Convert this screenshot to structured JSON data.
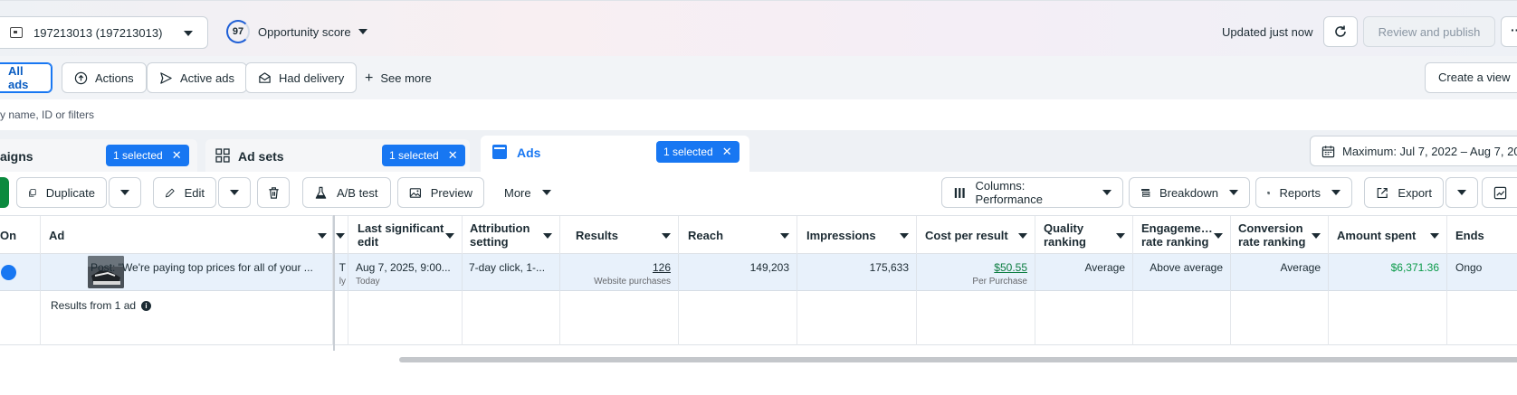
{
  "topbar": {
    "account": "197213013 (197213013)",
    "opportunity_score": "97",
    "opportunity_label": "Opportunity score",
    "updated": "Updated just now",
    "review_publish": "Review and publish",
    "more": "···"
  },
  "filters": {
    "all_ads": "All ads",
    "actions": "Actions",
    "active_ads": "Active ads",
    "had_delivery": "Had delivery",
    "see_more": "See more",
    "create_view": "Create a view"
  },
  "search": {
    "placeholder": "y name, ID or filters"
  },
  "tabs": {
    "campaigns": {
      "label": "aigns",
      "selected": "1 selected"
    },
    "adsets": {
      "label": "Ad sets",
      "selected": "1 selected"
    },
    "ads": {
      "label": "Ads",
      "selected": "1 selected"
    },
    "date_range": "Maximum: Jul 7, 2022 – Aug 7, 20"
  },
  "toolbar": {
    "duplicate": "Duplicate",
    "edit": "Edit",
    "ab_test": "A/B test",
    "preview": "Preview",
    "more": "More",
    "columns": "Columns: Performance",
    "breakdown": "Breakdown",
    "reports": "Reports",
    "export": "Export"
  },
  "table": {
    "headers": {
      "on": "On",
      "ad": "Ad",
      "last_edit_1": "Last significant",
      "last_edit_2": "edit",
      "attribution_1": "Attribution",
      "attribution_2": "setting",
      "results": "Results",
      "reach": "Reach",
      "impressions": "Impressions",
      "cost_per_result": "Cost per result",
      "quality_1": "Quality",
      "quality_2": "ranking",
      "engagement_1": "Engageme…",
      "engagement_2": "rate ranking",
      "conversion_1": "Conversion",
      "conversion_2": "rate ranking",
      "amount_spent": "Amount spent",
      "ends": "Ends"
    },
    "row": {
      "ad_name": "Post: \"We're paying top prices for all of your ...",
      "partial_col": "T",
      "partial_sub": "ly",
      "last_edit": "Aug 7, 2025, 9:00...",
      "last_edit_sub": "Today",
      "attribution": "7-day click, 1-...",
      "results": "126",
      "results_sub": "Website purchases",
      "reach": "149,203",
      "impressions": "175,633",
      "cost_per_result": "$50.55",
      "cost_sub": "Per Purchase",
      "quality": "Average",
      "engagement": "Above average",
      "conversion": "Average",
      "amount_spent": "$6,371.36",
      "ends": "Ongo"
    },
    "summary": "Results from 1 ad"
  },
  "colors": {
    "accent": "#1877f2",
    "spent": "#0a9a49",
    "link": "#0a7c3f"
  }
}
